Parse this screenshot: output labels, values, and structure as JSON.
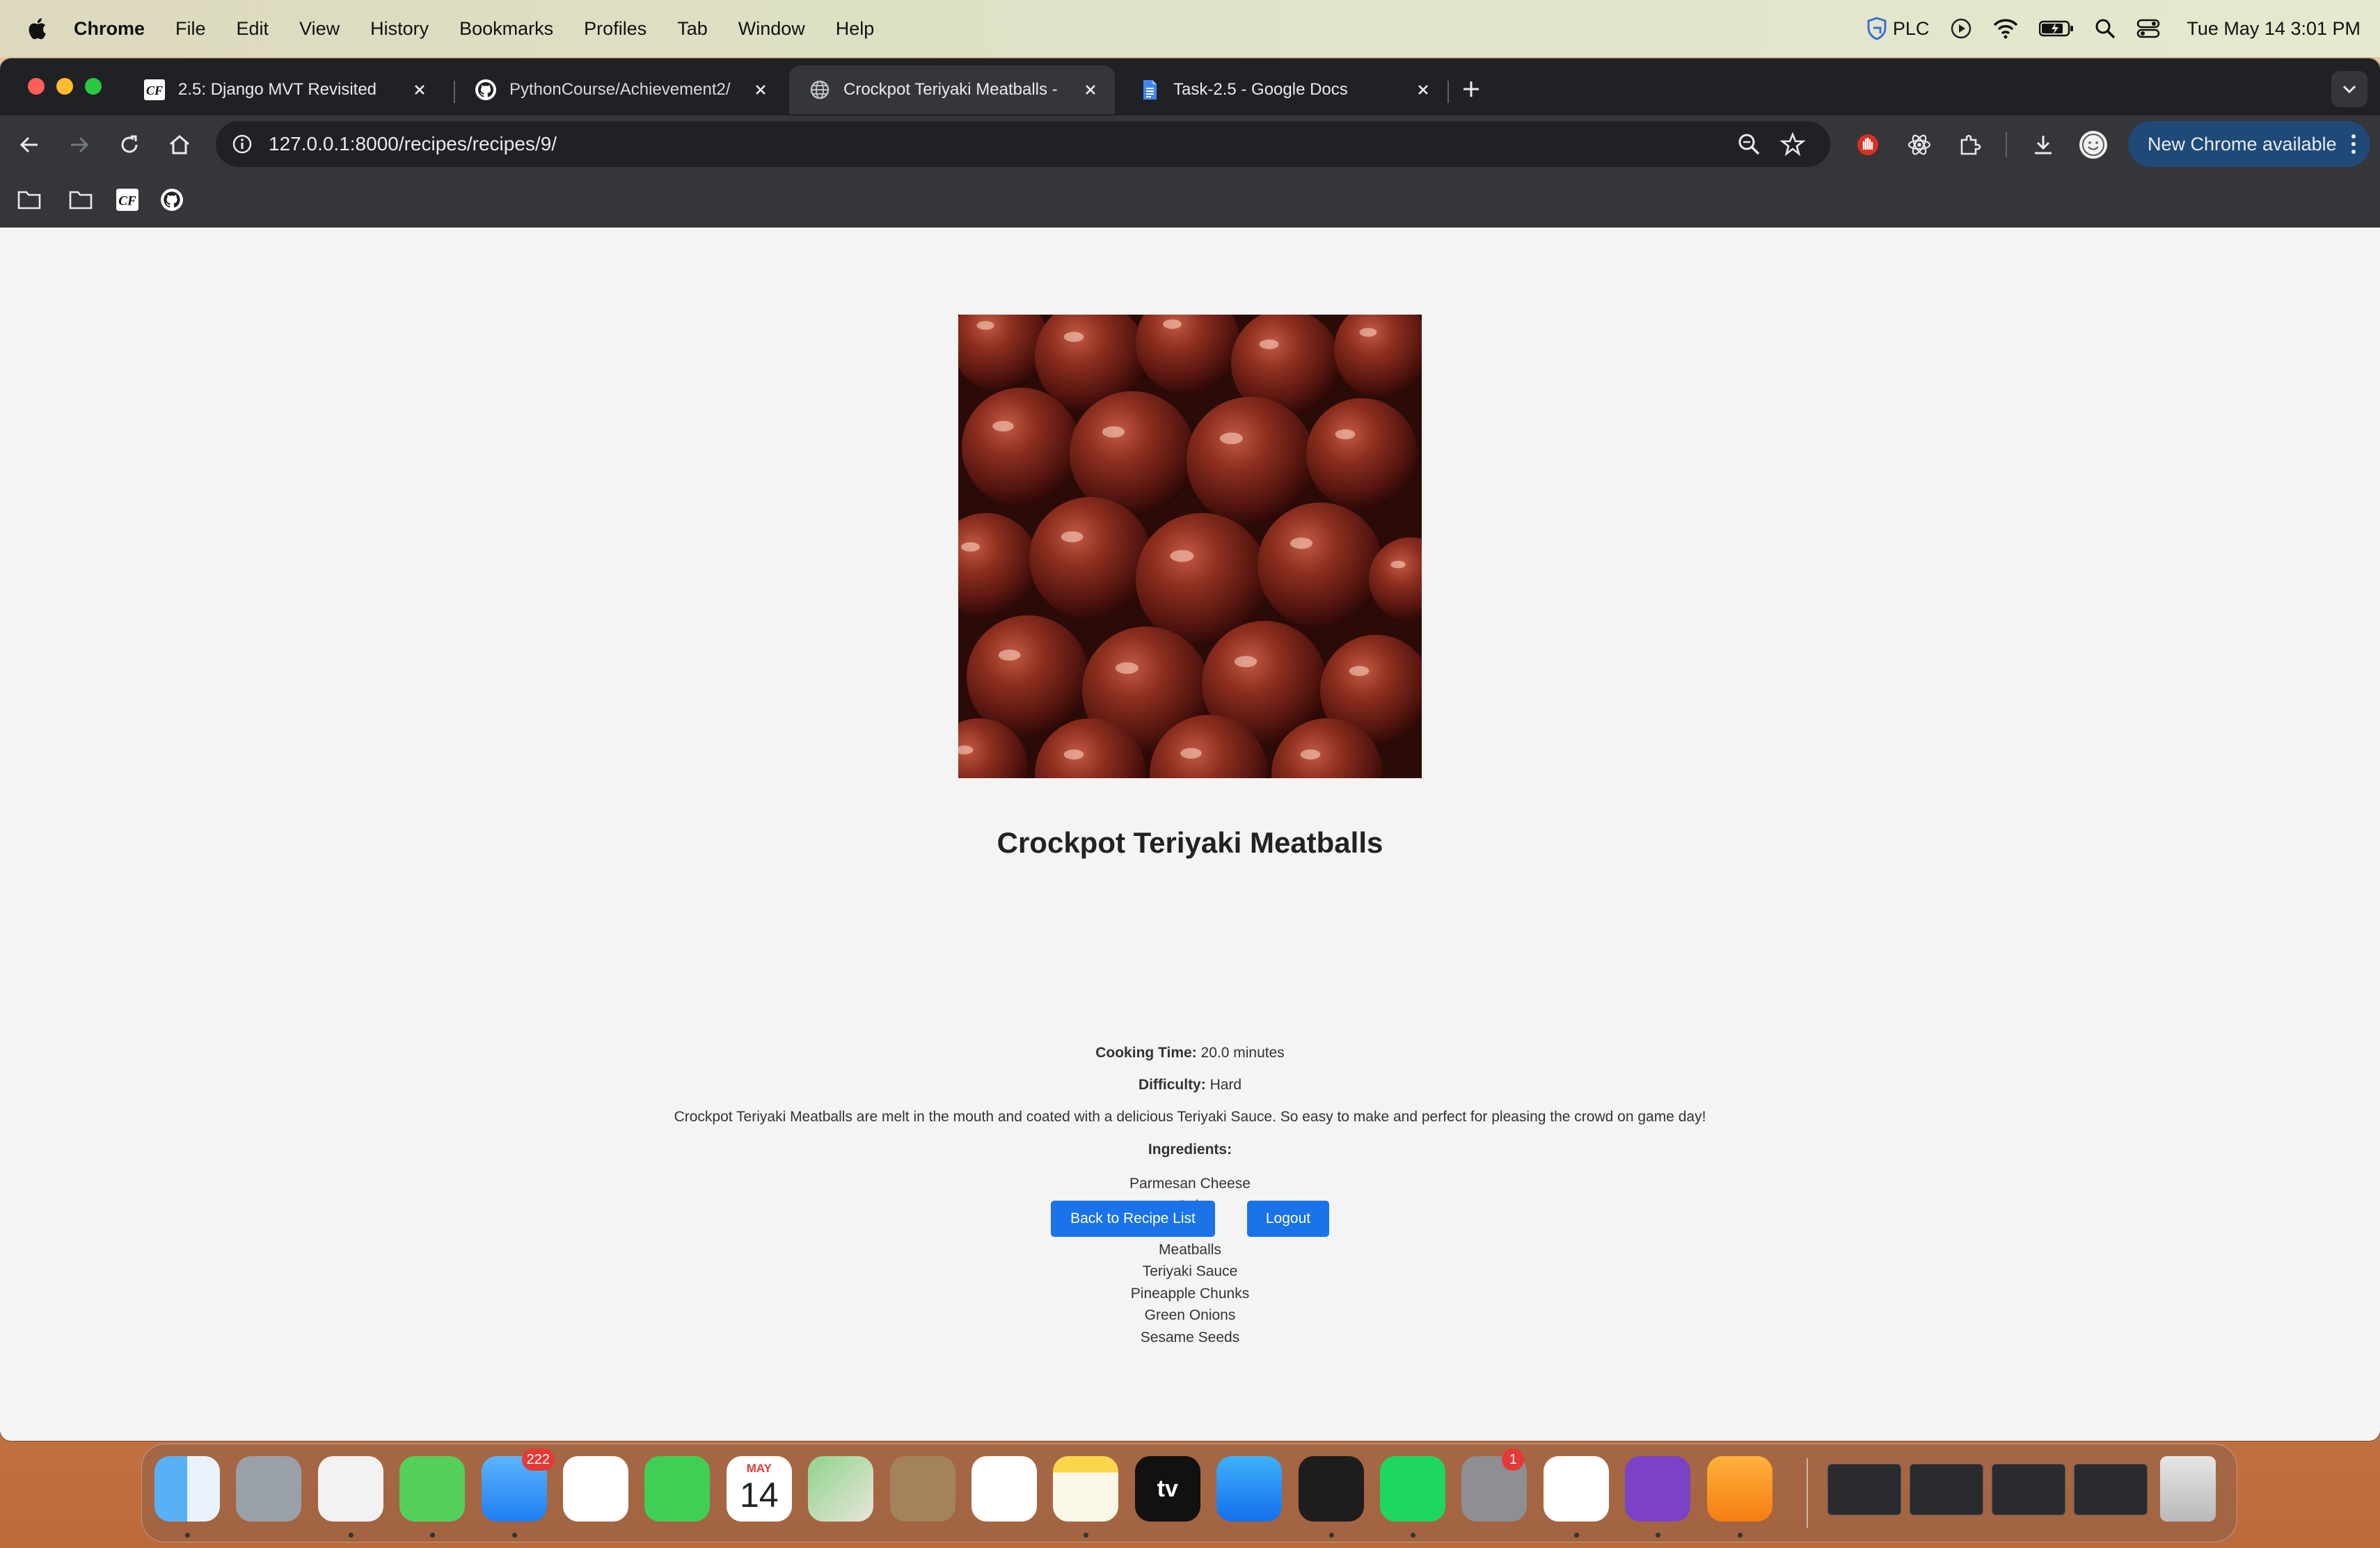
{
  "menubar": {
    "app": "Chrome",
    "items": [
      "File",
      "Edit",
      "View",
      "History",
      "Bookmarks",
      "Profiles",
      "Tab",
      "Window",
      "Help"
    ],
    "status_label": "PLC",
    "clock": "Tue May 14  3:01 PM"
  },
  "tabs": [
    {
      "title": "2.5: Django MVT Revisited",
      "icon": "cf-icon"
    },
    {
      "title": "PythonCourse/Achievement2/",
      "icon": "github-icon"
    },
    {
      "title": "Crockpot Teriyaki Meatballs -",
      "icon": "globe-icon",
      "active": true
    },
    {
      "title": "Task-2.5 - Google Docs",
      "icon": "google-docs-icon"
    }
  ],
  "toolbar": {
    "url": "127.0.0.1:8000/recipes/recipes/9/",
    "new_chrome": "New Chrome available"
  },
  "recipe": {
    "name": "Crockpot Teriyaki Meatballs",
    "cooking_time_label": "Cooking Time:",
    "cooking_time": "20.0 minutes",
    "difficulty_label": "Difficulty:",
    "difficulty": "Hard",
    "description": "Crockpot Teriyaki Meatballs are melt in the mouth and coated with a delicious Teriyaki Sauce. So easy to make and perfect for pleasing the crowd on game day!",
    "ingredients_label": "Ingredients:",
    "ingredients": [
      "Parmesan Cheese",
      "Salt",
      "Pepper",
      "Meatballs",
      "Teriyaki Sauce",
      "Pineapple Chunks",
      "Green Onions",
      "Sesame Seeds"
    ]
  },
  "buttons": {
    "back": "Back to Recipe List",
    "logout": "Logout"
  },
  "dock": {
    "badges": {
      "mail": "222",
      "settings": "1"
    },
    "calendar": {
      "month": "MAY",
      "day": "14"
    },
    "tv_label": "tv"
  },
  "colors": {
    "accent_button": "#1a73e8",
    "chrome_dark": "#202124",
    "chrome_toolbar": "#35363a",
    "page_bg": "#f4f4f4"
  }
}
